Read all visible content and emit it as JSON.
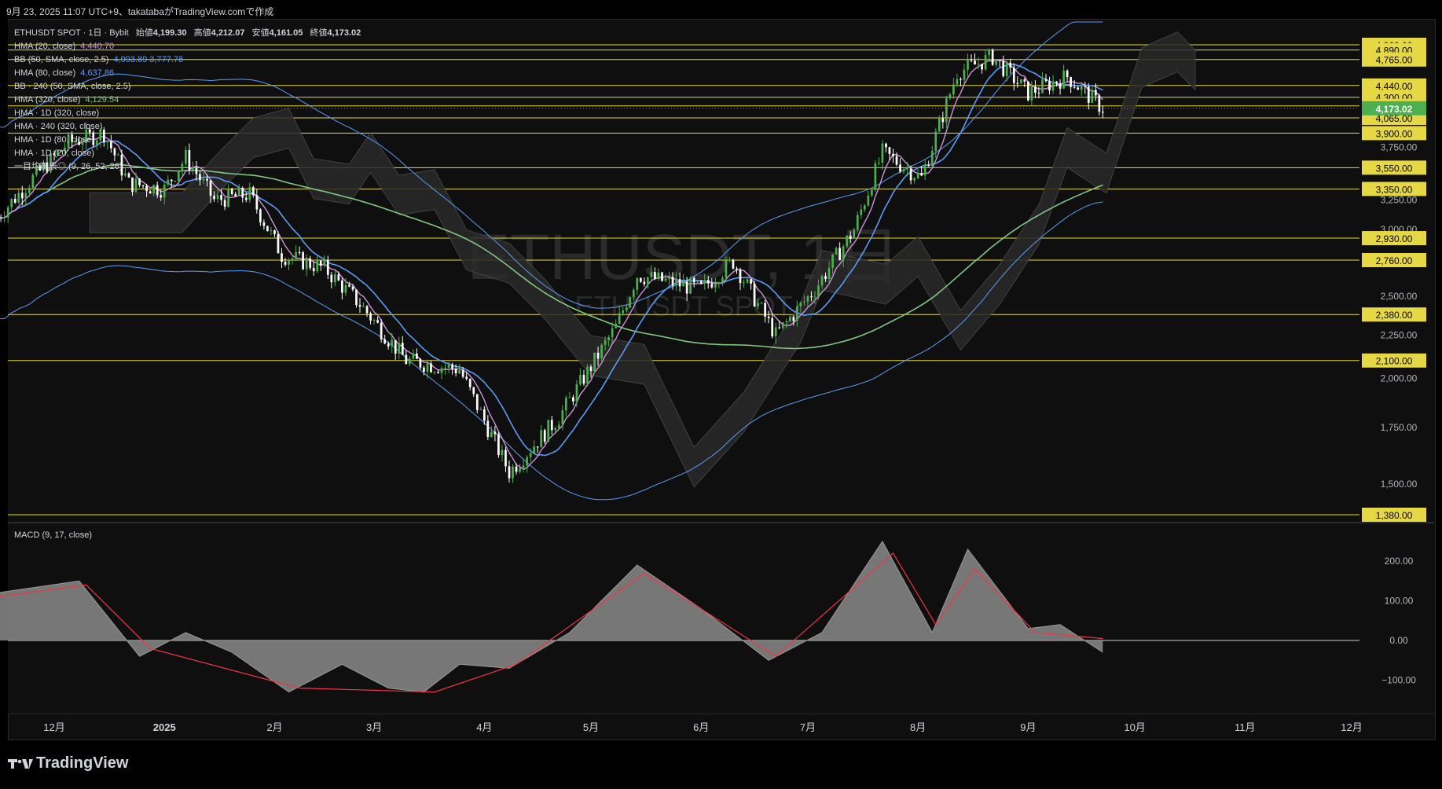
{
  "header": {
    "text": "9月 23, 2025 11:07 UTC+9、takatabaがTradingView.comで作成"
  },
  "legend": {
    "title": "ETHUSDT SPOT · 1日 · Bybit",
    "ohlc": [
      {
        "label": "始値",
        "value": "4,199.30"
      },
      {
        "label": "高値",
        "value": "4,212.07"
      },
      {
        "label": "安値",
        "value": "4,161.05"
      },
      {
        "label": "終値",
        "value": "4,173.02"
      }
    ],
    "indicators": [
      {
        "name": "HMA (20, close)",
        "value": "4,440.70",
        "color": "#ce93d8"
      },
      {
        "name": "BB (50, SMA, close, 2.5)",
        "value": "4,993.89  3,777.78",
        "color": "#5b9cf6"
      },
      {
        "name": "HMA (80, close)",
        "value": "4,637.86",
        "color": "#5b9cf6"
      },
      {
        "name": "BB · 240 (50, SMA, close, 2.5)",
        "value": "",
        "color": "#d1d4dc"
      },
      {
        "name": "HMA (320, close)",
        "value": "4,129.54",
        "color": "#81c784"
      },
      {
        "name": "HMA · 1D (320, close)",
        "value": "",
        "color": "#d1d4dc"
      },
      {
        "name": "HMA · 240 (320, close)",
        "value": "",
        "color": "#d1d4dc"
      },
      {
        "name": "HMA · 1D (80, close)",
        "value": "",
        "color": "#d1d4dc"
      },
      {
        "name": "HMA · 1D (20, close)",
        "value": "",
        "color": "#d1d4dc"
      },
      {
        "name": "一目均衡表◎ (9, 26, 52, 26)",
        "value": "",
        "color": "#d1d4dc"
      }
    ]
  },
  "watermark": {
    "main": "ETHUSDT, 1日",
    "sub": "ETHUSDT SPOT"
  },
  "macd_legend": "MACD (9, 17, close)",
  "footer": {
    "brand": "TradingView"
  },
  "colors": {
    "up": "#4caf50",
    "down": "#ffffff",
    "hline": "#e6d845",
    "hma20": "#ce93d8",
    "hma80": "#5b9cf6",
    "hma320": "#81c784",
    "bb": "#5b9cf6",
    "macd_fill": "#8a8a8a",
    "signal": "#f23645",
    "last_price_bg": "#4caf50"
  },
  "chart_data": [
    {
      "type": "candlestick",
      "title": "ETHUSDT, 1日",
      "y_axis": {
        "scale": "log",
        "ticks": [
          "1,500.00",
          "1,750.00",
          "2,000.00",
          "2,250.00",
          "2,500.00",
          "3,000.00",
          "3,250.00",
          "3,750.00"
        ],
        "tick_values": [
          1500,
          1750,
          2000,
          2250,
          2500,
          3000,
          3250,
          3750
        ]
      },
      "x_axis": {
        "ticks": [
          "12月",
          "2025",
          "2月",
          "3月",
          "4月",
          "5月",
          "6月",
          "7月",
          "8月",
          "9月",
          "10月",
          "11月",
          "12月"
        ],
        "tick_dates": [
          "2024-12-01",
          "2025-01-01",
          "2025-02-01",
          "2025-03-01",
          "2025-04-01",
          "2025-05-01",
          "2025-06-01",
          "2025-07-01",
          "2025-08-01",
          "2025-09-01",
          "2025-10-01",
          "2025-11-01",
          "2025-12-01"
        ]
      },
      "horizontal_levels": [
        {
          "value": 4960,
          "label": "4,960.00"
        },
        {
          "value": 4890,
          "label": "4,890.00"
        },
        {
          "value": 4765,
          "label": "4,765.00"
        },
        {
          "value": 4440,
          "label": "4,440.00"
        },
        {
          "value": 4300,
          "label": "4,300.00"
        },
        {
          "value": 4200,
          "label": "4,200.00"
        },
        {
          "value": 4065,
          "label": "4,065.00"
        },
        {
          "value": 3900,
          "label": "3,900.00"
        },
        {
          "value": 3550,
          "label": "3,550.00"
        },
        {
          "value": 3350,
          "label": "3,350.00"
        },
        {
          "value": 2930,
          "label": "2,930.00"
        },
        {
          "value": 2760,
          "label": "2,760.00"
        },
        {
          "value": 2380,
          "label": "2,380.00"
        },
        {
          "value": 2100,
          "label": "2,100.00"
        },
        {
          "value": 1380,
          "label": "1,380.00"
        }
      ],
      "last_price": {
        "value": 4173.02,
        "label": "4,173.02"
      },
      "close_path": [
        {
          "date": "2024-11-15",
          "close": 3100
        },
        {
          "date": "2024-11-25",
          "close": 3450
        },
        {
          "date": "2024-12-05",
          "close": 3800
        },
        {
          "date": "2024-12-15",
          "close": 3900
        },
        {
          "date": "2024-12-22",
          "close": 3400
        },
        {
          "date": "2025-01-01",
          "close": 3350
        },
        {
          "date": "2025-01-07",
          "close": 3650
        },
        {
          "date": "2025-01-15",
          "close": 3250
        },
        {
          "date": "2025-01-25",
          "close": 3300
        },
        {
          "date": "2025-02-03",
          "close": 2800
        },
        {
          "date": "2025-02-15",
          "close": 2700
        },
        {
          "date": "2025-02-25",
          "close": 2450
        },
        {
          "date": "2025-03-10",
          "close": 2100
        },
        {
          "date": "2025-03-25",
          "close": 2050
        },
        {
          "date": "2025-04-08",
          "close": 1550
        },
        {
          "date": "2025-04-22",
          "close": 1800
        },
        {
          "date": "2025-05-08",
          "close": 2300
        },
        {
          "date": "2025-05-14",
          "close": 2650
        },
        {
          "date": "2025-06-01",
          "close": 2550
        },
        {
          "date": "2025-06-10",
          "close": 2750
        },
        {
          "date": "2025-06-22",
          "close": 2250
        },
        {
          "date": "2025-07-03",
          "close": 2550
        },
        {
          "date": "2025-07-14",
          "close": 3000
        },
        {
          "date": "2025-07-22",
          "close": 3700
        },
        {
          "date": "2025-08-02",
          "close": 3450
        },
        {
          "date": "2025-08-12",
          "close": 4600
        },
        {
          "date": "2025-08-22",
          "close": 4800
        },
        {
          "date": "2025-09-01",
          "close": 4350
        },
        {
          "date": "2025-09-12",
          "close": 4550
        },
        {
          "date": "2025-09-22",
          "close": 4173
        }
      ],
      "series": [
        {
          "name": "HMA (20, close)",
          "last": 4440.7
        },
        {
          "name": "HMA (80, close)",
          "last": 4637.86
        },
        {
          "name": "HMA (320, close)",
          "last": 4129.54
        },
        {
          "name": "BB (50, SMA, close, 2.5)",
          "upper": 4993.89,
          "lower": 3777.78
        }
      ]
    },
    {
      "type": "area",
      "title": "MACD (9, 17, close)",
      "y_axis": {
        "ticks": [
          "200.00",
          "100.00",
          "0.00",
          "−100.00"
        ],
        "tick_values": [
          200,
          100,
          0,
          -100
        ]
      },
      "macd": [
        {
          "date": "2024-11-15",
          "value": 120
        },
        {
          "date": "2024-12-08",
          "value": 150
        },
        {
          "date": "2024-12-25",
          "value": -40
        },
        {
          "date": "2025-01-07",
          "value": 20
        },
        {
          "date": "2025-01-20",
          "value": -30
        },
        {
          "date": "2025-02-05",
          "value": -130
        },
        {
          "date": "2025-02-20",
          "value": -60
        },
        {
          "date": "2025-03-05",
          "value": -120
        },
        {
          "date": "2025-03-15",
          "value": -130
        },
        {
          "date": "2025-03-25",
          "value": -60
        },
        {
          "date": "2025-04-08",
          "value": -70
        },
        {
          "date": "2025-04-25",
          "value": 20
        },
        {
          "date": "2025-05-14",
          "value": 190
        },
        {
          "date": "2025-06-01",
          "value": 80
        },
        {
          "date": "2025-06-20",
          "value": -50
        },
        {
          "date": "2025-07-05",
          "value": 20
        },
        {
          "date": "2025-07-22",
          "value": 250
        },
        {
          "date": "2025-08-05",
          "value": 20
        },
        {
          "date": "2025-08-15",
          "value": 230
        },
        {
          "date": "2025-09-01",
          "value": 30
        },
        {
          "date": "2025-09-10",
          "value": 40
        },
        {
          "date": "2025-09-22",
          "value": -30
        }
      ],
      "signal": [
        {
          "date": "2024-11-15",
          "value": 110
        },
        {
          "date": "2024-12-10",
          "value": 140
        },
        {
          "date": "2024-12-28",
          "value": -20
        },
        {
          "date": "2025-02-08",
          "value": -120
        },
        {
          "date": "2025-03-18",
          "value": -130
        },
        {
          "date": "2025-04-10",
          "value": -60
        },
        {
          "date": "2025-05-16",
          "value": 170
        },
        {
          "date": "2025-06-22",
          "value": -40
        },
        {
          "date": "2025-07-25",
          "value": 220
        },
        {
          "date": "2025-08-06",
          "value": 40
        },
        {
          "date": "2025-08-17",
          "value": 180
        },
        {
          "date": "2025-09-03",
          "value": 20
        },
        {
          "date": "2025-09-22",
          "value": 5
        }
      ]
    }
  ]
}
